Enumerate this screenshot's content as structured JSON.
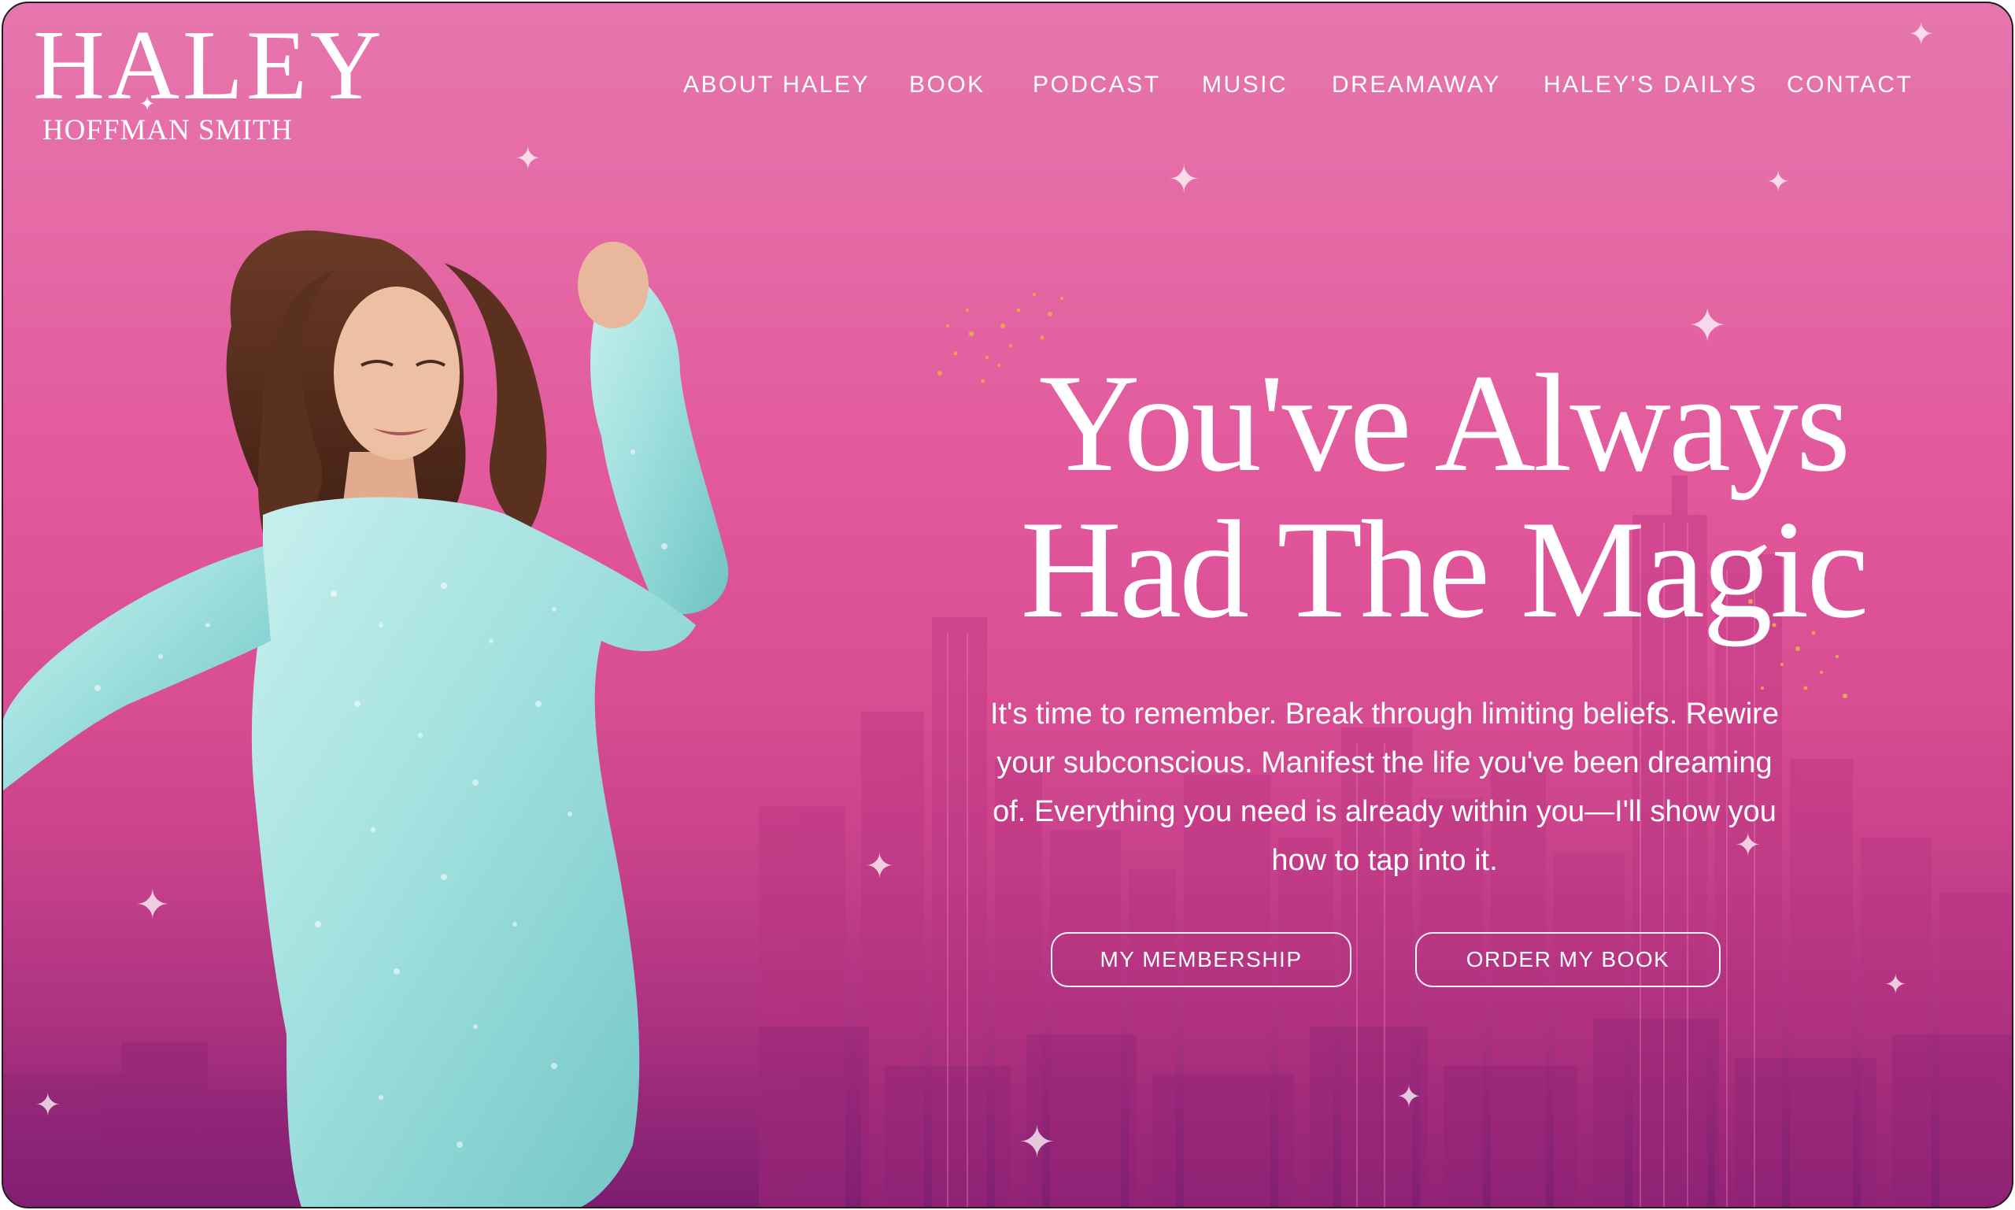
{
  "brand": {
    "name": "HALEY",
    "subtitle": "HOFFMAN SMITH"
  },
  "nav": {
    "items": [
      {
        "label": "ABOUT HALEY"
      },
      {
        "label": "BOOK"
      },
      {
        "label": "PODCAST"
      },
      {
        "label": "MUSIC"
      },
      {
        "label": "DREAMAWAY"
      },
      {
        "label": "HALEY'S DAILYS"
      },
      {
        "label": "CONTACT"
      }
    ]
  },
  "hero": {
    "title_line1": "You've Always",
    "title_line2": "Had The Magic",
    "body": "It's time to remember. Break through limiting beliefs. Rewire your subconscious. Manifest the life you've been dreaming of. Everything you need is already within you—I'll show you how to tap into it.",
    "primary_button": "MY MEMBERSHIP",
    "secondary_button": "ORDER MY BOOK"
  },
  "colors": {
    "background_top": "#e676ad",
    "background_mid": "#e2589b",
    "background_bottom": "#7c1d70",
    "text": "#ffffff",
    "dress": "#9fe0de"
  },
  "icons": {
    "logo_star": "four-point-star-icon",
    "sparkle": "sparkle-icon"
  }
}
